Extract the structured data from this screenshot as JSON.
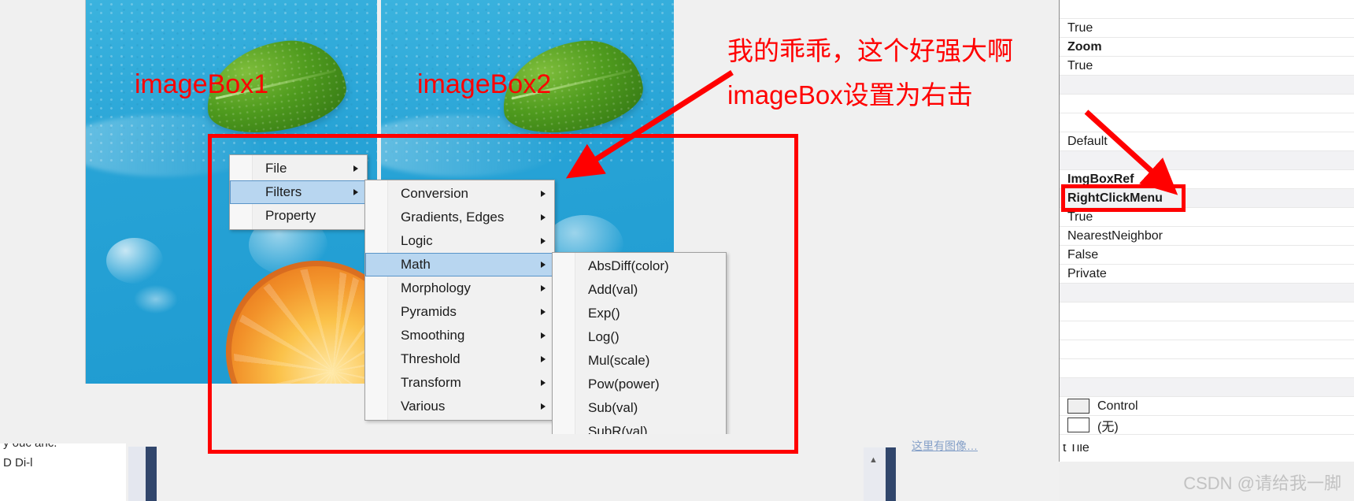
{
  "image_boxes": [
    {
      "label": "imageBox1"
    },
    {
      "label": "imageBox2"
    }
  ],
  "context_menu": {
    "level1": [
      {
        "label": "File",
        "has_submenu": true,
        "selected": false
      },
      {
        "label": "Filters",
        "has_submenu": true,
        "selected": true
      },
      {
        "label": "Property",
        "has_submenu": false,
        "selected": false
      }
    ],
    "level2": [
      {
        "label": "Conversion",
        "has_submenu": true,
        "selected": false
      },
      {
        "label": "Gradients, Edges",
        "has_submenu": true,
        "selected": false
      },
      {
        "label": "Logic",
        "has_submenu": true,
        "selected": false
      },
      {
        "label": "Math",
        "has_submenu": true,
        "selected": true
      },
      {
        "label": "Morphology",
        "has_submenu": true,
        "selected": false
      },
      {
        "label": "Pyramids",
        "has_submenu": true,
        "selected": false
      },
      {
        "label": "Smoothing",
        "has_submenu": true,
        "selected": false
      },
      {
        "label": "Threshold",
        "has_submenu": true,
        "selected": false
      },
      {
        "label": "Transform",
        "has_submenu": true,
        "selected": false
      },
      {
        "label": "Various",
        "has_submenu": true,
        "selected": false
      }
    ],
    "level3": [
      {
        "label": "AbsDiff(color)",
        "has_submenu": false,
        "selected": false
      },
      {
        "label": "Add(val)",
        "has_submenu": false,
        "selected": false
      },
      {
        "label": "Exp()",
        "has_submenu": false,
        "selected": false
      },
      {
        "label": "Log()",
        "has_submenu": false,
        "selected": false
      },
      {
        "label": "Mul(scale)",
        "has_submenu": false,
        "selected": false
      },
      {
        "label": "Pow(power)",
        "has_submenu": false,
        "selected": false
      },
      {
        "label": "Sub(val)",
        "has_submenu": false,
        "selected": false
      },
      {
        "label": "SubR(val)",
        "has_submenu": false,
        "selected": false
      }
    ]
  },
  "property_panel": {
    "rows": [
      {
        "value": "",
        "style": "blank"
      },
      {
        "value": "True",
        "style": "normal"
      },
      {
        "value": "Zoom",
        "style": "bold"
      },
      {
        "value": "True",
        "style": "normal"
      },
      {
        "value": "",
        "style": "group"
      },
      {
        "value": "",
        "style": "blank"
      },
      {
        "value": "",
        "style": "blank"
      },
      {
        "value": "Default",
        "style": "normal"
      },
      {
        "value": "",
        "style": "group"
      },
      {
        "value": "ImgBoxRef",
        "style": "bold"
      },
      {
        "value": "RightClickMenu",
        "style": "highlight"
      },
      {
        "value": "True",
        "style": "normal"
      },
      {
        "value": "NearestNeighbor",
        "style": "normal"
      },
      {
        "value": "False",
        "style": "normal"
      },
      {
        "value": "Private",
        "style": "normal"
      },
      {
        "value": "",
        "style": "group"
      },
      {
        "value": "",
        "style": "blank"
      },
      {
        "value": "",
        "style": "blank"
      },
      {
        "value": "",
        "style": "blank"
      },
      {
        "value": "",
        "style": "blank"
      },
      {
        "value": "",
        "style": "group"
      }
    ],
    "swatch_rows": [
      {
        "value": "Control",
        "swatch": "gray"
      },
      {
        "value": "(无)",
        "swatch": "white"
      }
    ],
    "partial_row": "t Tile"
  },
  "annotations": {
    "line1": "我的乖乖，这个好强大啊",
    "line2": "imageBox设置为右击",
    "color": "#ff0000"
  },
  "bottom": {
    "cut_text_1": "y ouc anc.",
    "cut_text_2": "D      Di-l",
    "link_text": "这里有图像…",
    "caret": "▲"
  },
  "watermark": "CSDN @请给我一脚",
  "colors": {
    "annotation_red": "#ff0000",
    "menu_selected": "#b8d6f0",
    "menu_selected_border": "#5a95c8",
    "photo_blue": "#27a3d6",
    "leaf_green": "#4f9b1e",
    "orange_fruit": "#f2922a",
    "panel_background": "#efefef"
  }
}
